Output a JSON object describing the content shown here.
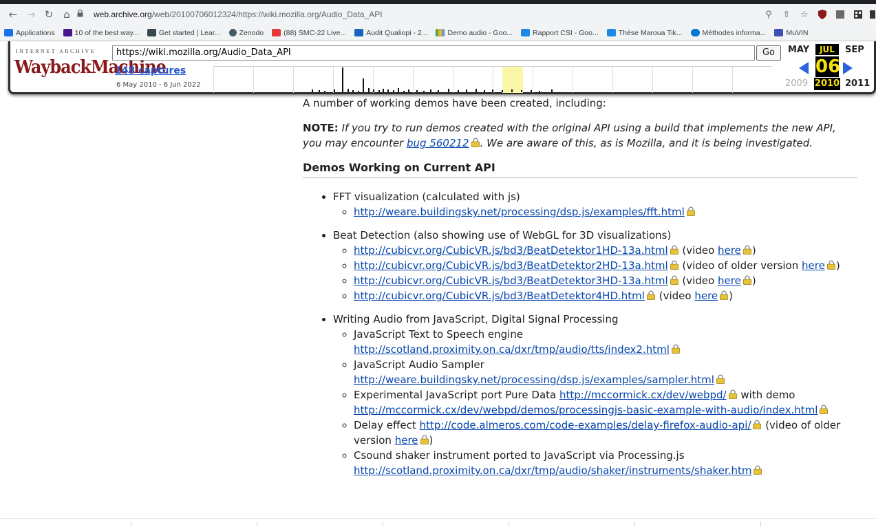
{
  "browser": {
    "url_host": "web.archive.org",
    "url_rest": "/web/20100706012324/https://wiki.mozilla.org/Audio_Data_API",
    "bookmarks": [
      {
        "label": "Applications",
        "color": "#1a73e8"
      },
      {
        "label": "10 of the best way...",
        "color": "#4a148c"
      },
      {
        "label": "Get started | Lear...",
        "color": "#37474f"
      },
      {
        "label": "Zenodo",
        "color": "#455a64"
      },
      {
        "label": "(88) SMC-22 Live...",
        "color": "#e53935"
      },
      {
        "label": "Audit Qualiopi - 2...",
        "color": "#1565c0"
      },
      {
        "label": "Demo audio - Goo...",
        "color": "#fbc02d"
      },
      {
        "label": "Rapport CSI - Goo...",
        "color": "#1e88e5"
      },
      {
        "label": "Thèse Maroua Tik...",
        "color": "#1e88e5"
      },
      {
        "label": "Méthodes informa...",
        "color": "#0078d4"
      },
      {
        "label": "MuVIN",
        "color": "#3f51b5"
      }
    ]
  },
  "wayback": {
    "logo_top": "INTERNET ARCHIVE",
    "logo_main": "WaybackMachine",
    "url_value": "https://wiki.mozilla.org/Audio_Data_API",
    "go_label": "Go",
    "captures": "148 captures",
    "range": "6 May 2010 - 6 Jun 2022",
    "month_prev": "MAY",
    "month_cur": "JUL",
    "month_next": "SEP",
    "day": "06",
    "year_prev": "2009",
    "year_cur": "2010",
    "year_next": "2011"
  },
  "content": {
    "intro": "A number of working demos have been created, including:",
    "note_label": "NOTE:",
    "note_text_1": " If you try to run demos created with the original API using a build that implements the new API, you may encounter ",
    "note_link": "bug 560212",
    "note_text_2": ". We are aware of this, as is Mozilla, and it is being investigated.",
    "section_title": "Demos Working on Current API",
    "fft": {
      "title": "FFT visualization (calculated with js)",
      "link": "http://weare.buildingsky.net/processing/dsp.js/examples/fft.html"
    },
    "beat": {
      "title": "Beat Detection (also showing use of WebGL for 3D visualizations)",
      "link1": "http://cubicvr.org/CubicVR.js/bd3/BeatDetektor1HD-13a.html",
      "link2": "http://cubicvr.org/CubicVR.js/bd3/BeatDetektor2HD-13a.html",
      "link3": "http://cubicvr.org/CubicVR.js/bd3/BeatDetektor3HD-13a.html",
      "link4": "http://cubicvr.org/CubicVR.js/bd3/BeatDetektor4HD.html",
      "video_open": "(video ",
      "video_older_open": "(video of older version",
      "here": "here",
      "close": ")"
    },
    "writing": {
      "title": "Writing Audio from JavaScript, Digital Signal Processing",
      "tts_title": "JavaScript Text to Speech engine",
      "tts_link": "http://scotland.proximity.on.ca/dxr/tmp/audio/tts/index2.html",
      "sampler_title": "JavaScript Audio Sampler",
      "sampler_link": "http://weare.buildingsky.net/processing/dsp.js/examples/sampler.html",
      "pd_title": "Experimental JavaScript port Pure Data ",
      "pd_link": "http://mccormick.cx/dev/webpd/",
      "pd_with_demo": " with demo",
      "pd_demo_link": "http://mccormick.cx/dev/webpd/demos/processingjs-basic-example-with-audio/index.html",
      "delay_title": "Delay effect ",
      "delay_link": "http://code.almeros.com/code-examples/delay-firefox-audio-api/",
      "delay_video": " (video of older version ",
      "shaker_title": "Csound shaker instrument ported to JavaScript via Processing.js",
      "shaker_link": "http://scotland.proximity.on.ca/dxr/tmp/audio/shaker/instruments/shaker.htm"
    }
  }
}
